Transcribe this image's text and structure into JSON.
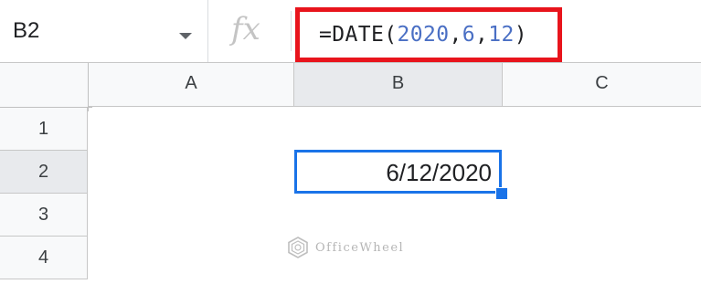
{
  "name_box": {
    "cell_ref": "B2",
    "dropdown_icon": "caret-down-icon"
  },
  "formula_bar": {
    "fx_label": "fx",
    "formula_tokens": [
      {
        "text": "=DATE(",
        "kind": "fn"
      },
      {
        "text": "2020",
        "kind": "num"
      },
      {
        "text": ",",
        "kind": "punct"
      },
      {
        "text": "6",
        "kind": "num"
      },
      {
        "text": ",",
        "kind": "punct"
      },
      {
        "text": "12",
        "kind": "num"
      },
      {
        "text": ")",
        "kind": "punct"
      }
    ],
    "highlight_color": "#e8141c"
  },
  "columns": [
    {
      "label": "A",
      "selected": false
    },
    {
      "label": "B",
      "selected": true
    },
    {
      "label": "C",
      "selected": false
    }
  ],
  "rows": [
    {
      "label": "1",
      "selected": false
    },
    {
      "label": "2",
      "selected": true
    },
    {
      "label": "3",
      "selected": false
    },
    {
      "label": "4",
      "selected": false
    }
  ],
  "active_cell": {
    "ref": "B2",
    "value": "6/12/2020",
    "accent_color": "#1a73e8"
  },
  "watermark": {
    "text": "OfficeWheel",
    "icon": "officewheel-logo-icon"
  }
}
